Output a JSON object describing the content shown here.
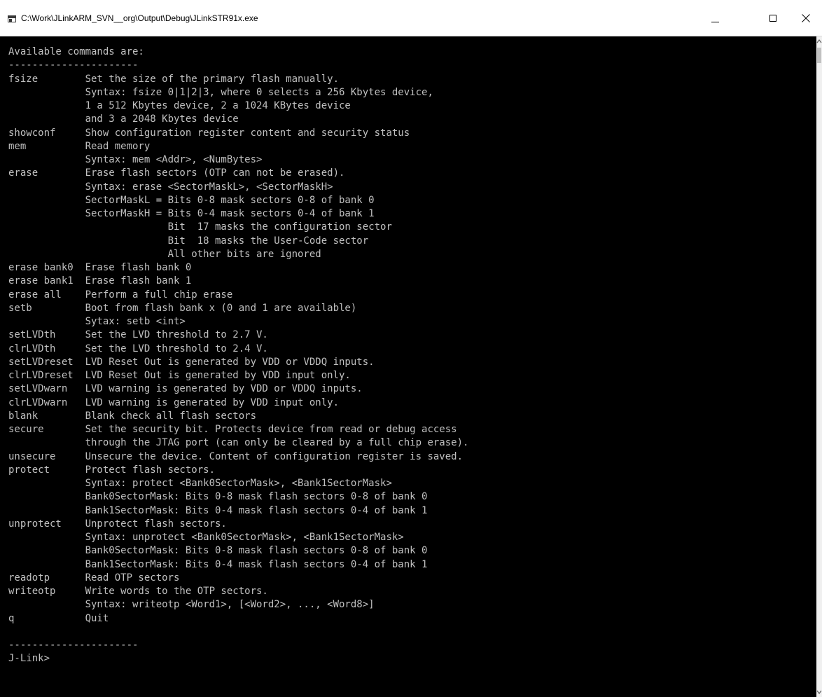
{
  "window": {
    "title": "C:\\Work\\JLinkARM_SVN__org\\Output\\Debug\\JLinkSTR91x.exe",
    "icon": "console-app-icon",
    "controls": {
      "minimize": "minimize-icon",
      "maximize": "maximize-icon",
      "close": "close-icon"
    }
  },
  "console": {
    "text_color": "#c0c0c0",
    "background": "#000000",
    "lines": [
      "Available commands are:",
      "----------------------",
      "fsize        Set the size of the primary flash manually.",
      "             Syntax: fsize 0|1|2|3, where 0 selects a 256 Kbytes device,",
      "             1 a 512 Kbytes device, 2 a 1024 KBytes device",
      "             and 3 a 2048 Kbytes device",
      "showconf     Show configuration register content and security status",
      "mem          Read memory",
      "             Syntax: mem <Addr>, <NumBytes>",
      "erase        Erase flash sectors (OTP can not be erased).",
      "             Syntax: erase <SectorMaskL>, <SectorMaskH>",
      "             SectorMaskL = Bits 0-8 mask sectors 0-8 of bank 0",
      "             SectorMaskH = Bits 0-4 mask sectors 0-4 of bank 1",
      "                           Bit  17 masks the configuration sector",
      "                           Bit  18 masks the User-Code sector",
      "                           All other bits are ignored",
      "erase bank0  Erase flash bank 0",
      "erase bank1  Erase flash bank 1",
      "erase all    Perform a full chip erase",
      "setb         Boot from flash bank x (0 and 1 are available)",
      "             Sytax: setb <int>",
      "setLVDth     Set the LVD threshold to 2.7 V.",
      "clrLVDth     Set the LVD threshold to 2.4 V.",
      "setLVDreset  LVD Reset Out is generated by VDD or VDDQ inputs.",
      "clrLVDreset  LVD Reset Out is generated by VDD input only.",
      "setLVDwarn   LVD warning is generated by VDD or VDDQ inputs.",
      "clrLVDwarn   LVD warning is generated by VDD input only.",
      "blank        Blank check all flash sectors",
      "secure       Set the security bit. Protects device from read or debug access",
      "             through the JTAG port (can only be cleared by a full chip erase).",
      "unsecure     Unsecure the device. Content of configuration register is saved.",
      "protect      Protect flash sectors.",
      "             Syntax: protect <Bank0SectorMask>, <Bank1SectorMask>",
      "             Bank0SectorMask: Bits 0-8 mask flash sectors 0-8 of bank 0",
      "             Bank1SectorMask: Bits 0-4 mask flash sectors 0-4 of bank 1",
      "unprotect    Unprotect flash sectors.",
      "             Syntax: unprotect <Bank0SectorMask>, <Bank1SectorMask>",
      "             Bank0SectorMask: Bits 0-8 mask flash sectors 0-8 of bank 0",
      "             Bank1SectorMask: Bits 0-4 mask flash sectors 0-4 of bank 1",
      "readotp      Read OTP sectors",
      "writeotp     Write words to the OTP sectors.",
      "             Syntax: writeotp <Word1>, [<Word2>, ..., <Word8>]",
      "q            Quit",
      "",
      "----------------------",
      "J-Link>"
    ]
  }
}
